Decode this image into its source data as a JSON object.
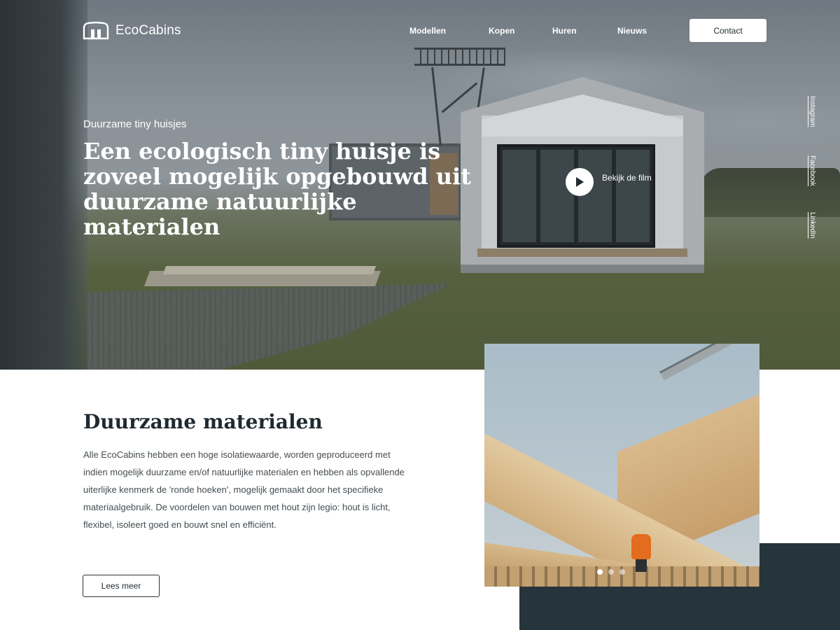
{
  "brand": {
    "name": "EcoCabins"
  },
  "nav": {
    "items": [
      "Modellen",
      "Kopen",
      "Huren",
      "Nieuws"
    ],
    "contact_label": "Contact"
  },
  "hero": {
    "eyebrow": "Duurzame tiny huisjes",
    "title": "Een ecologisch tiny huisje is zoveel mogelijk opgebouwd uit duurzame natuurlijke materialen",
    "video_label": "Bekijk de film",
    "video_icon": "play-icon"
  },
  "social": {
    "items": [
      "Instagram",
      "Facebook",
      "LinkedIn"
    ]
  },
  "section": {
    "title": "Duurzame materialen",
    "body": "Alle EcoCabins hebben een hoge isolatiewaarde, worden geproduceerd met indien mogelijk duurzame en/of natuurlijke materialen en hebben als opvallende uiterlijke kenmerk de 'ronde hoeken', mogelijk gemaakt door het specifieke materiaalgebruik. De voordelen van bouwen met hout zijn legio: hout is licht, flexibel, isoleert goed en bouwt snel en efficiënt.",
    "button_label": "Lees meer"
  },
  "carousel": {
    "slides": 3,
    "active": 1
  },
  "colors": {
    "dark": "#26343b",
    "text": "#1f2a30",
    "white": "#ffffff"
  }
}
